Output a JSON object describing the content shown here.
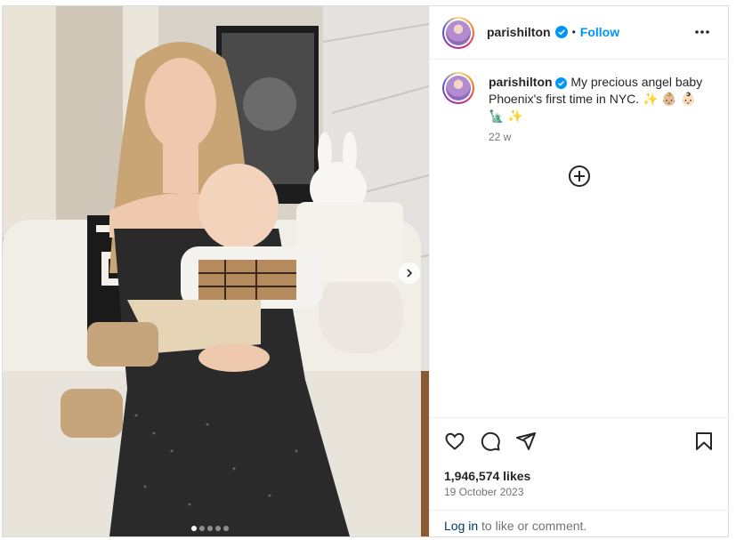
{
  "post": {
    "username": "parishilton",
    "follow_label": "Follow",
    "separator": "•",
    "more_label": "...",
    "caption_text": "My precious angel baby Phoenix's first time in NYC. ✨ 👶🏼 👶🏻 🗽 ✨",
    "time_ago": "22 w",
    "likes": "1,946,574 likes",
    "date": "19 October 2023",
    "login_link": "Log in",
    "login_rest": " to like or comment.",
    "carousel_total": 5,
    "carousel_active": 0
  },
  "icons": {
    "verified": "verified-badge-icon",
    "more": "more-options-icon",
    "add": "add-circle-icon",
    "like": "heart-icon",
    "comment": "comment-icon",
    "share": "share-icon",
    "save": "bookmark-icon",
    "next": "chevron-right-icon"
  },
  "colors": {
    "accent": "#0095f6",
    "verified": "#0095f6",
    "text": "#262626",
    "secondary": "#737373"
  }
}
